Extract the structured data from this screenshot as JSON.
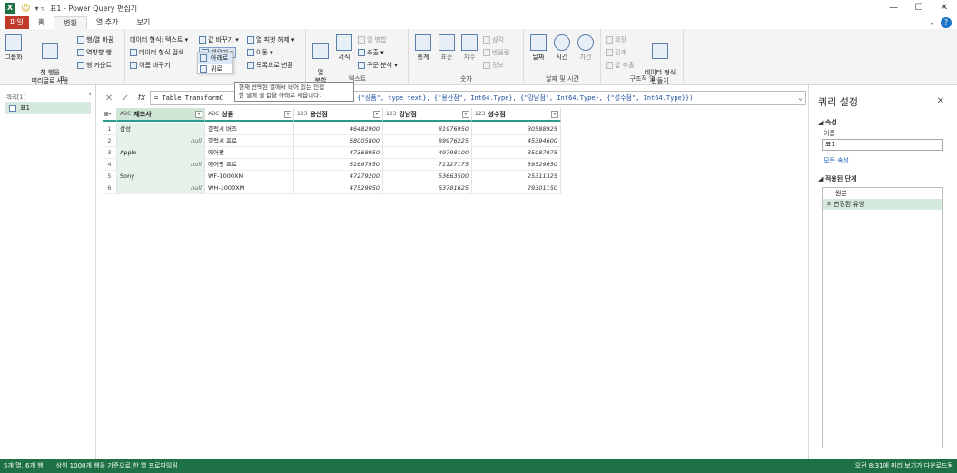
{
  "window": {
    "title": "표1 - Power Query 편집기",
    "app_badge": "X",
    "controls": {
      "minimize": "—",
      "maximize": "☐",
      "close": "✕"
    }
  },
  "menu": {
    "tabs": [
      "파일",
      "홈",
      "변환",
      "열 추가",
      "보기"
    ],
    "active": "변환",
    "help": "?"
  },
  "ribbon": {
    "groups": {
      "table": {
        "label": "표",
        "group_by": "그룹화",
        "use_first_row": "첫 행을\n머리글로 사용",
        "transpose": "행/열 바꿈",
        "reverse_rows": "역방향 행",
        "count_rows": "행 카운트"
      },
      "any_column": {
        "label": "",
        "data_type": "데이터 형식: 텍스트",
        "detect_type": "데이터 형식 검색",
        "rename": "이름 바꾸기",
        "replace_values": "값 바꾸기",
        "fill": "채우기",
        "fill_down": "아래로",
        "fill_up": "위로",
        "unpivot": "열 피벗 해제",
        "move": "이동",
        "convert_to_list": "목록으로 변환"
      },
      "text": {
        "label": "텍스트",
        "split": "열\n분할",
        "format": "서식",
        "merge": "열 병합",
        "extract": "추출",
        "parse": "구문 분석"
      },
      "number": {
        "label": "숫자",
        "statistics": "통계",
        "standard": "표준",
        "scientific": "지수",
        "trigonometry": "삼각",
        "rounding": "반올림",
        "information": "정보"
      },
      "datetime": {
        "label": "날짜 및 시간",
        "date": "날짜",
        "time": "시간",
        "duration": "기간"
      },
      "structured": {
        "label": "구조적 열",
        "expand": "확장",
        "aggregate": "집계",
        "extract_values": "값 추출",
        "json_xml": "데이터 형식\n만들기"
      }
    },
    "tooltip": "현재 선택된 열에서 비어 있는 인접\n한 셀에 셀 값을 아래로 채웁니다."
  },
  "queries_pane": {
    "header": "쿼리[1]",
    "items": [
      "표1"
    ]
  },
  "formula_bar": {
    "cancel": "✕",
    "commit": "✓",
    "fx": "fx",
    "prefix": "= Table.TransformColumnTypes(",
    "visible_text": "= Table.TransformC",
    "tail": "text}, {\"상품\", type text}, {\"용산점\", Int64.Type}, {\"강남점\", Int64.Type}, {\"성수점\", Int64.Type}})"
  },
  "table": {
    "columns": [
      {
        "name": "제조사",
        "type_icon": "ABC"
      },
      {
        "name": "상품",
        "type_icon": "ABC"
      },
      {
        "name": "용산점",
        "type_icon": "123"
      },
      {
        "name": "강남점",
        "type_icon": "123"
      },
      {
        "name": "성수점",
        "type_icon": "123"
      }
    ],
    "rows": [
      {
        "idx": "1",
        "maker": "삼성",
        "product": "갤럭시 버즈",
        "yongsan": "46482900",
        "gangnam": "81976950",
        "seongsu": "30588925"
      },
      {
        "idx": "2",
        "maker": "null",
        "product": "갤럭시 프로",
        "yongsan": "68005800",
        "gangnam": "89976225",
        "seongsu": "45394600"
      },
      {
        "idx": "3",
        "maker": "Apple",
        "product": "에어팟",
        "yongsan": "47368950",
        "gangnam": "49798100",
        "seongsu": "35087975"
      },
      {
        "idx": "4",
        "maker": "null",
        "product": "에어팟 프로",
        "yongsan": "61697950",
        "gangnam": "71127175",
        "seongsu": "39529650"
      },
      {
        "idx": "5",
        "maker": "Sony",
        "product": "WF-1000XM",
        "yongsan": "47279200",
        "gangnam": "53663500",
        "seongsu": "25311325"
      },
      {
        "idx": "6",
        "maker": "null",
        "product": "WH-1000XM",
        "yongsan": "47529050",
        "gangnam": "63781625",
        "seongsu": "29301150"
      }
    ]
  },
  "settings_pane": {
    "title": "쿼리 설정",
    "properties_header": "속성",
    "name_label": "이름",
    "name_value": "표1",
    "all_properties": "모든 속성",
    "steps_header": "적용된 단계",
    "steps": [
      "원본",
      "변경된 유형"
    ]
  },
  "status": {
    "left": "5개 열, 6개 행",
    "mid": "상위 1000개 행을 기준으로 한 열 프로파일링",
    "right": "오전 8:31에 미리 보기가 다운로드됨"
  },
  "colors": {
    "excel_green": "#1e7145",
    "file_tab": "#c0392b",
    "header_underline": "#2e9c8c",
    "selected": "#cfe6d6"
  }
}
